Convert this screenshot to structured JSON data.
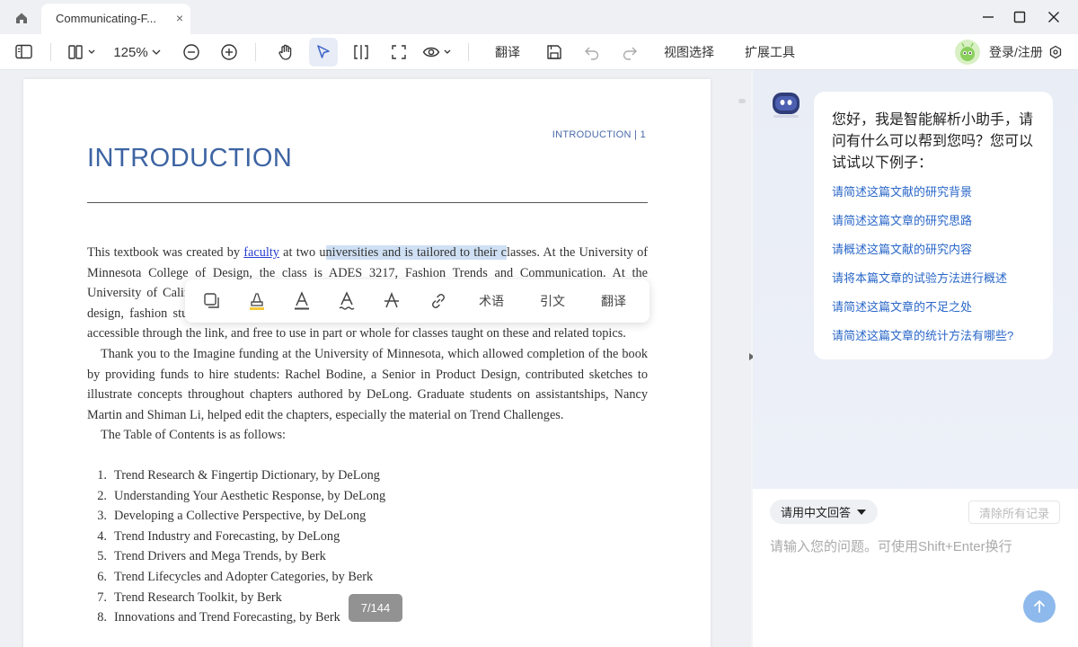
{
  "tab": {
    "title": "Communicating-F...",
    "close": "×"
  },
  "toolbar": {
    "zoom": "125%",
    "translate": "翻译",
    "view_select": "视图选择",
    "extensions": "扩展工具",
    "login": "登录/注册"
  },
  "document": {
    "header": "INTRODUCTION  |  1",
    "title": "INTRODUCTION",
    "p1": {
      "a": "This textbook was created by ",
      "link": "faculty",
      "b": " at two u",
      "highlight": "niversities and is tailored to their c",
      "c": "lasses. At the University of Minnesota College of Design, the class is ADES 3217, Fashion Trends and Communication. At the University of California, the class is taught to students in majors related to design, product and apparel design, fashion studies, technology, textiles, retail merchandising, marketing, and business. The book is accessible through the link, and free to use in part or whole for classes taught on these and related topics."
    },
    "p2": "Thank you to the Imagine funding at the University of Minnesota, which allowed completion of the book by providing funds to hire students:  Rachel Bodine, a Senior in Product Design, contributed sketches to illustrate concepts throughout chapters authored by DeLong. Graduate students on assistantships, Nancy Martin and Shiman Li, helped edit the chapters, especially the material on Trend Challenges.",
    "p3": "The Table of Contents is as follows:",
    "toc": [
      {
        "num": "1.",
        "text": "Trend Research & Fingertip Dictionary, by DeLong"
      },
      {
        "num": "2.",
        "text": "Understanding Your Aesthetic Response, by DeLong"
      },
      {
        "num": "3.",
        "text": "Developing a Collective Perspective, by DeLong"
      },
      {
        "num": "4.",
        "text": "Trend Industry and Forecasting, by DeLong"
      },
      {
        "num": "5.",
        "text": "Trend Drivers and Mega Trends, by Berk"
      },
      {
        "num": "6.",
        "text": "Trend Lifecycles and Adopter Categories, by Berk"
      },
      {
        "num": "7.",
        "text": "Trend Research Toolkit, by Berk"
      },
      {
        "num": "8.",
        "text": "Innovations and Trend Forecasting, by Berk"
      }
    ],
    "page_indicator": "7/144"
  },
  "float_toolbar": {
    "term": "术语",
    "cite": "引文",
    "translate": "翻译"
  },
  "chat": {
    "greeting": "您好，我是智能解析小助手，请问有什么可以帮到您吗？您可以试试以下例子：",
    "suggestions": [
      "请简述这篇文献的研究背景",
      "请简述这篇文章的研究思路",
      "请概述这篇文献的研究内容",
      "请将本篇文章的试验方法进行概述",
      "请简述这篇文章的不足之处",
      "请简述这篇文章的统计方法有哪些?"
    ],
    "lang_button": "请用中文回答",
    "clear_button": "清除所有记录",
    "input_placeholder": "请输入您的问题。可使用Shift+Enter换行"
  },
  "colors": {
    "accent": "#3d64a3",
    "link": "#2a67c8",
    "highlight": "#cfe0f4",
    "send": "#8db9ec"
  }
}
